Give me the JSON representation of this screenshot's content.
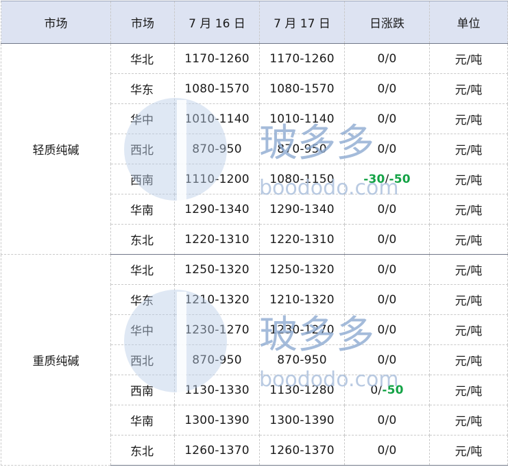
{
  "header": {
    "col1": "市场",
    "col2": "市场",
    "col3": "7 月 16 日",
    "col4": "7 月 17 日",
    "col5": "日涨跌",
    "col6": "单位"
  },
  "groups": [
    {
      "name": "轻质纯碱",
      "rows": [
        {
          "region": "华北",
          "d16": "1170-1260",
          "d17": "1170-1260",
          "change_a": "0",
          "change_b": "0",
          "neg_a": false,
          "neg_b": false,
          "unit": "元/吨"
        },
        {
          "region": "华东",
          "d16": "1080-1570",
          "d17": "1080-1570",
          "change_a": "0",
          "change_b": "0",
          "neg_a": false,
          "neg_b": false,
          "unit": "元/吨"
        },
        {
          "region": "华中",
          "d16": "1010-1140",
          "d17": "1010-1140",
          "change_a": "0",
          "change_b": "0",
          "neg_a": false,
          "neg_b": false,
          "unit": "元/吨"
        },
        {
          "region": "西北",
          "d16": "870-950",
          "d17": "870-950",
          "change_a": "0",
          "change_b": "0",
          "neg_a": false,
          "neg_b": false,
          "unit": "元/吨"
        },
        {
          "region": "西南",
          "d16": "1110-1200",
          "d17": "1080-1150",
          "change_a": "-30",
          "change_b": "-50",
          "neg_a": true,
          "neg_b": true,
          "unit": "元/吨"
        },
        {
          "region": "华南",
          "d16": "1290-1340",
          "d17": "1290-1340",
          "change_a": "0",
          "change_b": "0",
          "neg_a": false,
          "neg_b": false,
          "unit": "元/吨"
        },
        {
          "region": "东北",
          "d16": "1220-1310",
          "d17": "1220-1310",
          "change_a": "0",
          "change_b": "0",
          "neg_a": false,
          "neg_b": false,
          "unit": "元/吨"
        }
      ]
    },
    {
      "name": "重质纯碱",
      "rows": [
        {
          "region": "华北",
          "d16": "1250-1320",
          "d17": "1250-1320",
          "change_a": "0",
          "change_b": "0",
          "neg_a": false,
          "neg_b": false,
          "unit": "元/吨"
        },
        {
          "region": "华东",
          "d16": "1210-1320",
          "d17": "1210-1320",
          "change_a": "0",
          "change_b": "0",
          "neg_a": false,
          "neg_b": false,
          "unit": "元/吨"
        },
        {
          "region": "华中",
          "d16": "1230-1270",
          "d17": "1230-1270",
          "change_a": "0",
          "change_b": "0",
          "neg_a": false,
          "neg_b": false,
          "unit": "元/吨"
        },
        {
          "region": "西北",
          "d16": "870-950",
          "d17": "870-950",
          "change_a": "0",
          "change_b": "0",
          "neg_a": false,
          "neg_b": false,
          "unit": "元/吨"
        },
        {
          "region": "西南",
          "d16": "1130-1330",
          "d17": "1130-1280",
          "change_a": "0",
          "change_b": "-50",
          "neg_a": false,
          "neg_b": true,
          "unit": "元/吨"
        },
        {
          "region": "华南",
          "d16": "1300-1390",
          "d17": "1300-1390",
          "change_a": "0",
          "change_b": "0",
          "neg_a": false,
          "neg_b": false,
          "unit": "元/吨"
        },
        {
          "region": "东北",
          "d16": "1260-1370",
          "d17": "1260-1370",
          "change_a": "0",
          "change_b": "0",
          "neg_a": false,
          "neg_b": false,
          "unit": "元/吨"
        }
      ]
    }
  ],
  "watermark": {
    "brand_text": "玻多多",
    "url_text": "boododo.com",
    "color": "#9fb8d8"
  },
  "colors": {
    "header_bg": "#dde3f2",
    "negative": "#14a346"
  }
}
